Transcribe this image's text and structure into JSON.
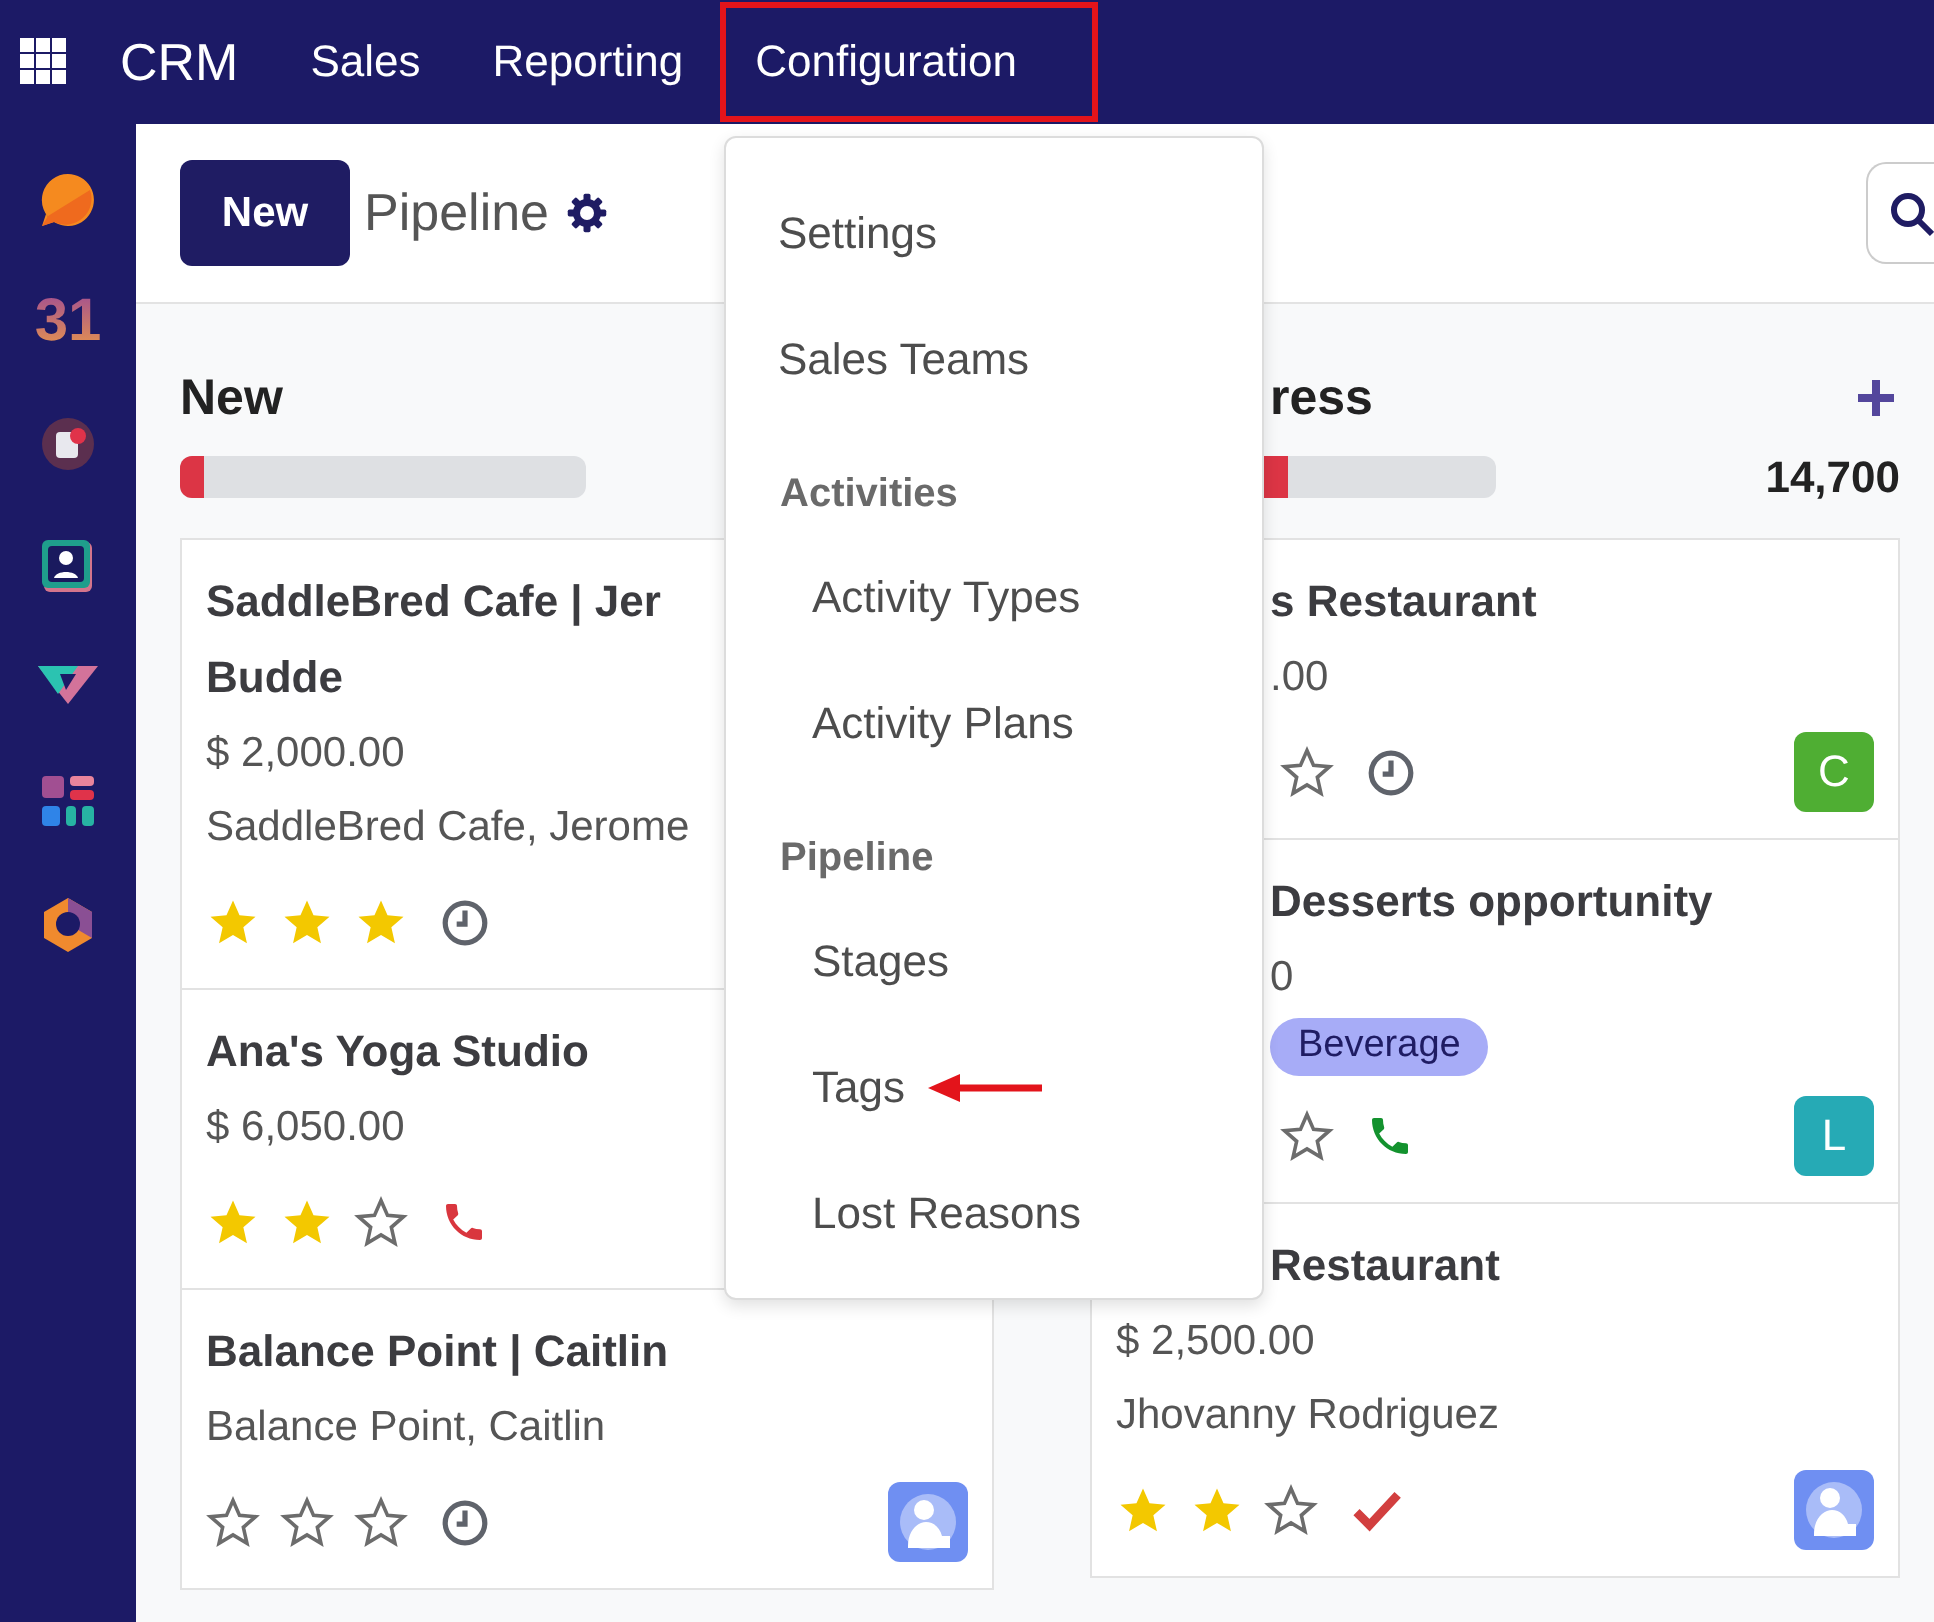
{
  "navbar": {
    "brand": "CRM",
    "menus": [
      {
        "label": "Sales",
        "highlighted": false
      },
      {
        "label": "Reporting",
        "highlighted": false
      },
      {
        "label": "Configuration",
        "highlighted": true
      }
    ]
  },
  "sidebar": {
    "apps": [
      {
        "kind": "chat"
      },
      {
        "kind": "calendar",
        "text": "31"
      },
      {
        "kind": "appointment"
      },
      {
        "kind": "contacts"
      },
      {
        "kind": "diamond"
      },
      {
        "kind": "dashboard"
      },
      {
        "kind": "hexagon"
      }
    ]
  },
  "control_panel": {
    "new_button": "New",
    "title": "Pipeline"
  },
  "columns": [
    {
      "title": "New",
      "level": 0.06,
      "cards": [
        {
          "title_lines": [
            "SaddleBred Cafe | Jer",
            "Budde"
          ],
          "amount": "$ 2,000.00",
          "contact": "SaddleBred Cafe, Jerome",
          "stars": 3,
          "activity": {
            "kind": "clock",
            "color": "#5f636b"
          }
        },
        {
          "title_lines": [
            "Ana's Yoga Studio"
          ],
          "amount": "$ 6,050.00",
          "stars": 2,
          "activity": {
            "kind": "phone",
            "color": "#d9363e"
          }
        },
        {
          "title_lines": [
            "Balance Point | Caitlin"
          ],
          "contact": "Balance Point, Caitlin",
          "stars": 0,
          "activity": {
            "kind": "clock",
            "color": "#5f636b"
          },
          "avatar": {
            "kind": "picture"
          }
        }
      ]
    },
    {
      "title": "ress",
      "level": 0.49,
      "total": "14,700",
      "cards": [
        {
          "title_lines": [
            "s Restaurant"
          ],
          "amount": ".00",
          "activity": {
            "kind": "clock",
            "color": "#5f636b"
          },
          "avatar": {
            "kind": "letter",
            "text": "C",
            "color": "#4fae33"
          }
        },
        {
          "title_lines": [
            "Desserts opportunity"
          ],
          "amount": "0",
          "tags": [
            "Beverage"
          ],
          "activity": {
            "kind": "phone",
            "color": "#13922e"
          },
          "avatar": {
            "kind": "letter",
            "text": "L",
            "color": "#26aab5"
          }
        },
        {
          "title_lines": [
            "Restaurant"
          ],
          "amount": "$ 2,500.00",
          "contact": "Jhovanny Rodriguez",
          "stars": 2,
          "activity": {
            "kind": "check",
            "color": "#d23f3f"
          },
          "avatar": {
            "kind": "picture"
          }
        }
      ]
    }
  ],
  "menu": {
    "items": [
      {
        "kind": "item",
        "label": "Settings",
        "pointer_arrow": false
      },
      {
        "kind": "item",
        "label": "Sales Teams",
        "pointer_arrow": false
      },
      {
        "kind": "header",
        "label": "Activities",
        "pointer_arrow": false
      },
      {
        "kind": "subitem",
        "label": "Activity Types",
        "pointer_arrow": false
      },
      {
        "kind": "subitem",
        "label": "Activity Plans",
        "pointer_arrow": false
      },
      {
        "kind": "header",
        "label": "Pipeline",
        "pointer_arrow": false
      },
      {
        "kind": "subitem",
        "label": "Stages",
        "pointer_arrow": false
      },
      {
        "kind": "subitem",
        "label": "Tags",
        "pointer_arrow": true
      },
      {
        "kind": "subitem",
        "label": "Lost Reasons",
        "pointer_arrow": false
      }
    ]
  }
}
